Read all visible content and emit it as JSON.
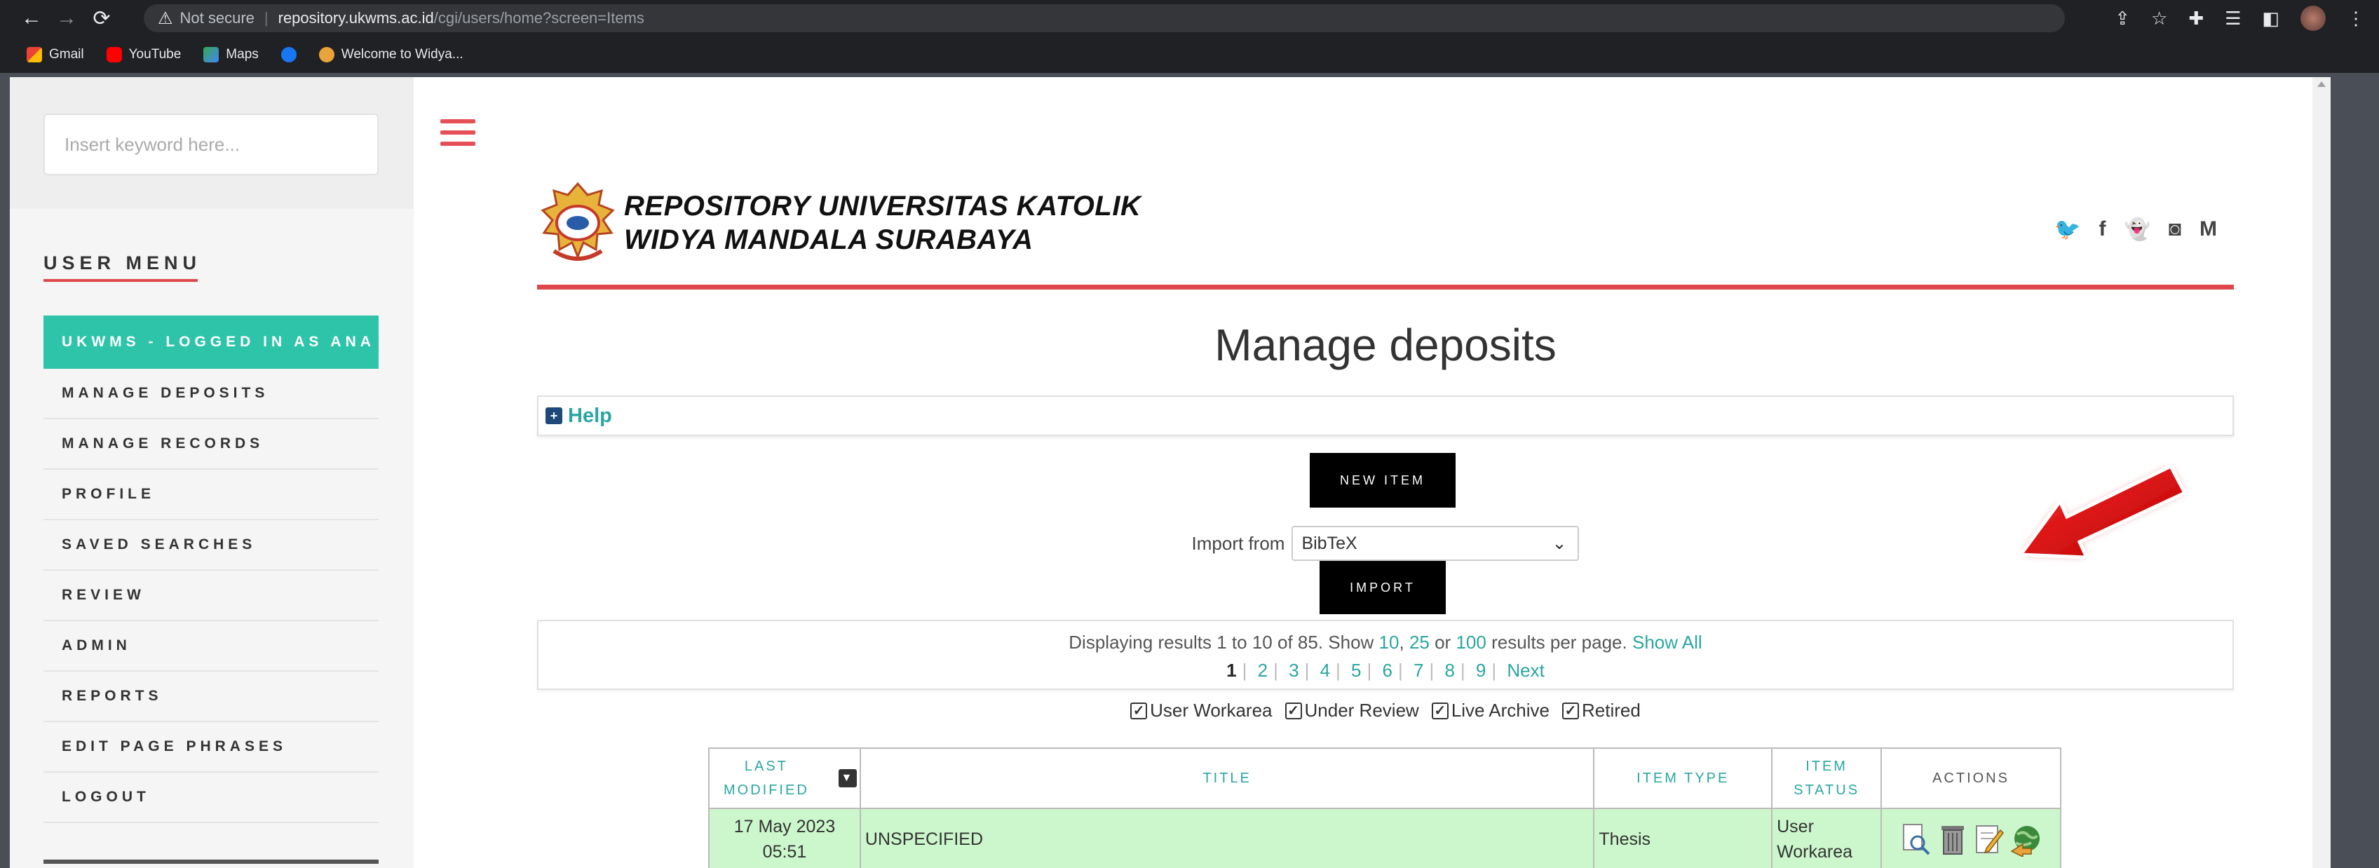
{
  "browser": {
    "security_label": "Not secure",
    "url_host": "repository.ukwms.ac.id",
    "url_path": "/cgi/users/home?screen=Items",
    "bookmarks": [
      {
        "label": "Gmail",
        "icon": "gmail-icon"
      },
      {
        "label": "YouTube",
        "icon": "youtube-icon"
      },
      {
        "label": "Maps",
        "icon": "maps-icon"
      },
      {
        "label": "",
        "icon": "facebook-icon"
      },
      {
        "label": "Welcome to Widya...",
        "icon": "widya-icon"
      }
    ]
  },
  "sidebar": {
    "search_placeholder": "Insert keyword here...",
    "menu_title": "USER MENU",
    "items": [
      {
        "label": "UKWMS - LOGGED IN AS ANA",
        "active": true
      },
      {
        "label": "MANAGE DEPOSITS"
      },
      {
        "label": "MANAGE RECORDS"
      },
      {
        "label": "PROFILE"
      },
      {
        "label": "SAVED SEARCHES"
      },
      {
        "label": "REVIEW"
      },
      {
        "label": "ADMIN"
      },
      {
        "label": "REPORTS"
      },
      {
        "label": "EDIT PAGE PHRASES"
      },
      {
        "label": "LOGOUT"
      }
    ]
  },
  "header": {
    "brand_line1": "REPOSITORY UNIVERSITAS KATOLIK",
    "brand_line2": "WIDYA MANDALA SURABAYA",
    "social_icons": [
      "twitter-icon",
      "facebook-icon",
      "snapchat-icon",
      "instagram-icon",
      "medium-icon"
    ]
  },
  "main": {
    "title": "Manage deposits",
    "help_label": "Help",
    "new_item_label": "NEW ITEM",
    "import_label": "Import from",
    "import_selected": "BibTeX",
    "import_button_label": "IMPORT",
    "results": {
      "prefix": "Displaying results 1 to 10 of 85. Show",
      "opt10": "10",
      "sep1": ",",
      "opt25": "25",
      "or": "or",
      "opt100": "100",
      "suffix": "results per page.",
      "show_all": "Show All",
      "pages": [
        "1",
        "2",
        "3",
        "4",
        "5",
        "6",
        "7",
        "8",
        "9"
      ],
      "next": "Next"
    },
    "filters": [
      "User Workarea",
      "Under Review",
      "Live Archive",
      "Retired"
    ],
    "table": {
      "headers": {
        "last_modified_1": "LAST",
        "last_modified_2": "MODIFIED",
        "title": "TITLE",
        "item_type": "ITEM TYPE",
        "item_status_1": "ITEM",
        "item_status_2": "STATUS",
        "actions": "ACTIONS"
      },
      "rows": [
        {
          "date_1": "17 May 2023",
          "date_2": "05:51",
          "title": "UNSPECIFIED",
          "type": "Thesis",
          "status_1": "User",
          "status_2": "Workarea"
        }
      ]
    }
  },
  "colors": {
    "accent_red": "#e0474c",
    "teal": "#2aa6a0",
    "active_menu": "#2ec4a9",
    "row_green": "#ccf7cc"
  }
}
